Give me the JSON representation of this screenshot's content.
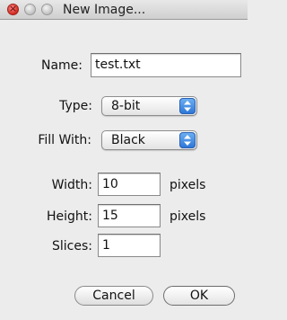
{
  "window": {
    "title": "New Image...",
    "close_glyph": "×"
  },
  "form": {
    "name_label": "Name:",
    "name_value": "test.txt",
    "type_label": "Type:",
    "type_value": "8-bit",
    "fill_label": "Fill With:",
    "fill_value": "Black",
    "width_label": "Width:",
    "width_value": "10",
    "width_unit": "pixels",
    "height_label": "Height:",
    "height_value": "15",
    "height_unit": "pixels",
    "slices_label": "Slices:",
    "slices_value": "1"
  },
  "buttons": {
    "cancel": "Cancel",
    "ok": "OK"
  },
  "colors": {
    "window_bg": "#ececec",
    "accent": "#2a74d6",
    "close_red": "#d2281f"
  }
}
